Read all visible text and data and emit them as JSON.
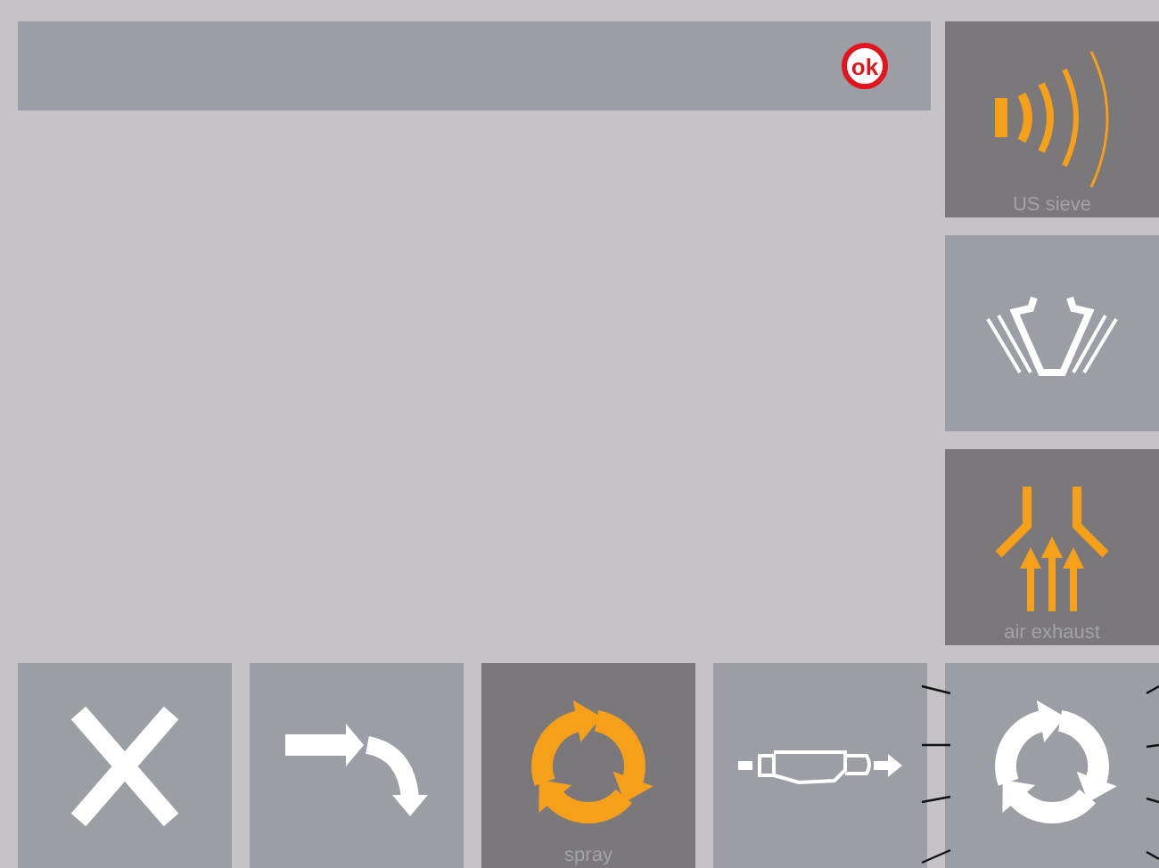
{
  "top_bar": {
    "badge": "ok"
  },
  "side_buttons": [
    {
      "kind": "sound",
      "label": "US sieve",
      "selected": true
    },
    {
      "kind": "cone",
      "selected": false
    },
    {
      "kind": "exhaust",
      "label": "air exhaust",
      "selected": true
    }
  ],
  "bottom_buttons": [
    {
      "kind": "close",
      "selected": false
    },
    {
      "kind": "turn",
      "selected": false
    },
    {
      "kind": "cycle",
      "label": "spray",
      "selected": true
    },
    {
      "kind": "nozzle",
      "selected": false
    },
    {
      "kind": "cycle",
      "selected": false
    }
  ]
}
